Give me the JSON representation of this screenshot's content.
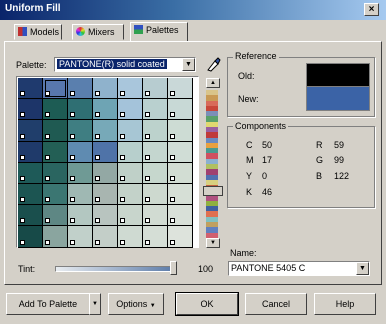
{
  "window": {
    "title": "Uniform Fill",
    "close_glyph": "×"
  },
  "tabs": [
    {
      "label": "Models",
      "active": false
    },
    {
      "label": "Mixers",
      "active": false
    },
    {
      "label": "Palettes",
      "active": true
    }
  ],
  "palette": {
    "label": "Palette:",
    "value": "PANTONE(R) solid coated"
  },
  "swatches": {
    "columns": 7,
    "rows": [
      [
        "#1f3a6e",
        "#5877ad",
        "#5a7fae",
        "#8fb2cc",
        "#a9c6dc",
        "#b7ccd0",
        "#c9d8d8"
      ],
      [
        "#1d3569",
        "#1d5c54",
        "#2f6f73",
        "#6ea4b4",
        "#a4c3da",
        "#b9d0cf",
        "#c8d9d6"
      ],
      [
        "#203e6b",
        "#1f5a52",
        "#3f7e82",
        "#77a9b8",
        "#a7c6d4",
        "#bcd2cc",
        "#cddcd4"
      ],
      [
        "#1f3a6a",
        "#235f55",
        "#5f8bb1",
        "#4f73a8",
        "#b7cfcc",
        "#c4d6cf",
        "#d0ddd6"
      ],
      [
        "#1e5a58",
        "#2a6560",
        "#6f9a95",
        "#93a8a4",
        "#bfd0c8",
        "#c6d7cd",
        "#d2ddd3"
      ],
      [
        "#1c5552",
        "#3b7672",
        "#9fb8b3",
        "#a8b5b0",
        "#c3d2c9",
        "#cdd9cf",
        "#d6dfd6"
      ],
      [
        "#1a4f4d",
        "#5e8784",
        "#b3c7c1",
        "#b8c4bf",
        "#c8d5cc",
        "#d1dbd2",
        "#d8e0d8"
      ],
      [
        "#174a48",
        "#8aa59f",
        "#c1d0ca",
        "#c3cec8",
        "#cfdad2",
        "#d5ded6",
        "#dde3dc"
      ]
    ],
    "selected_color": "#5877ad"
  },
  "strip_colors": [
    "#d9c48a",
    "#c99a55",
    "#d86a5a",
    "#c8463a",
    "#7c8fb8",
    "#5aa06a",
    "#e0d870",
    "#9a5fa0",
    "#c03a3a",
    "#6a8ac0",
    "#e8a040",
    "#4a9a90",
    "#d05060",
    "#8ab0d0",
    "#b0c060",
    "#a04070",
    "#5070b0",
    "#d8d080",
    "#c06040",
    "#70a0a0",
    "#b05080",
    "#90b040",
    "#4060a0",
    "#e07050",
    "#80c0c0",
    "#c0a060",
    "#6080c0",
    "#d06070"
  ],
  "reference": {
    "title": "Reference",
    "old_label": "Old:",
    "new_label": "New:",
    "old_color": "#000000",
    "new_color": "#3b63a6"
  },
  "components": {
    "title": "Components",
    "c_label": "C",
    "c_value": "50",
    "m_label": "M",
    "m_value": "17",
    "y_label": "Y",
    "y_value": "0",
    "k_label": "K",
    "k_value": "46",
    "r_label": "R",
    "r_value": "59",
    "g_label": "G",
    "g_value": "99",
    "b_label": "B",
    "b_value": "122"
  },
  "name": {
    "label": "Name:",
    "value": "PANTONE 5405 C"
  },
  "tint": {
    "label": "Tint:",
    "value": "100",
    "level_percent": 100
  },
  "buttons": {
    "add_to_palette": "Add To Palette",
    "options": "Options",
    "ok": "OK",
    "cancel": "Cancel",
    "help": "Help"
  },
  "icons": {
    "eyedropper": "eyedropper-icon",
    "dropdown": "▼",
    "scroll_up": "▲",
    "scroll_down": "▼"
  }
}
